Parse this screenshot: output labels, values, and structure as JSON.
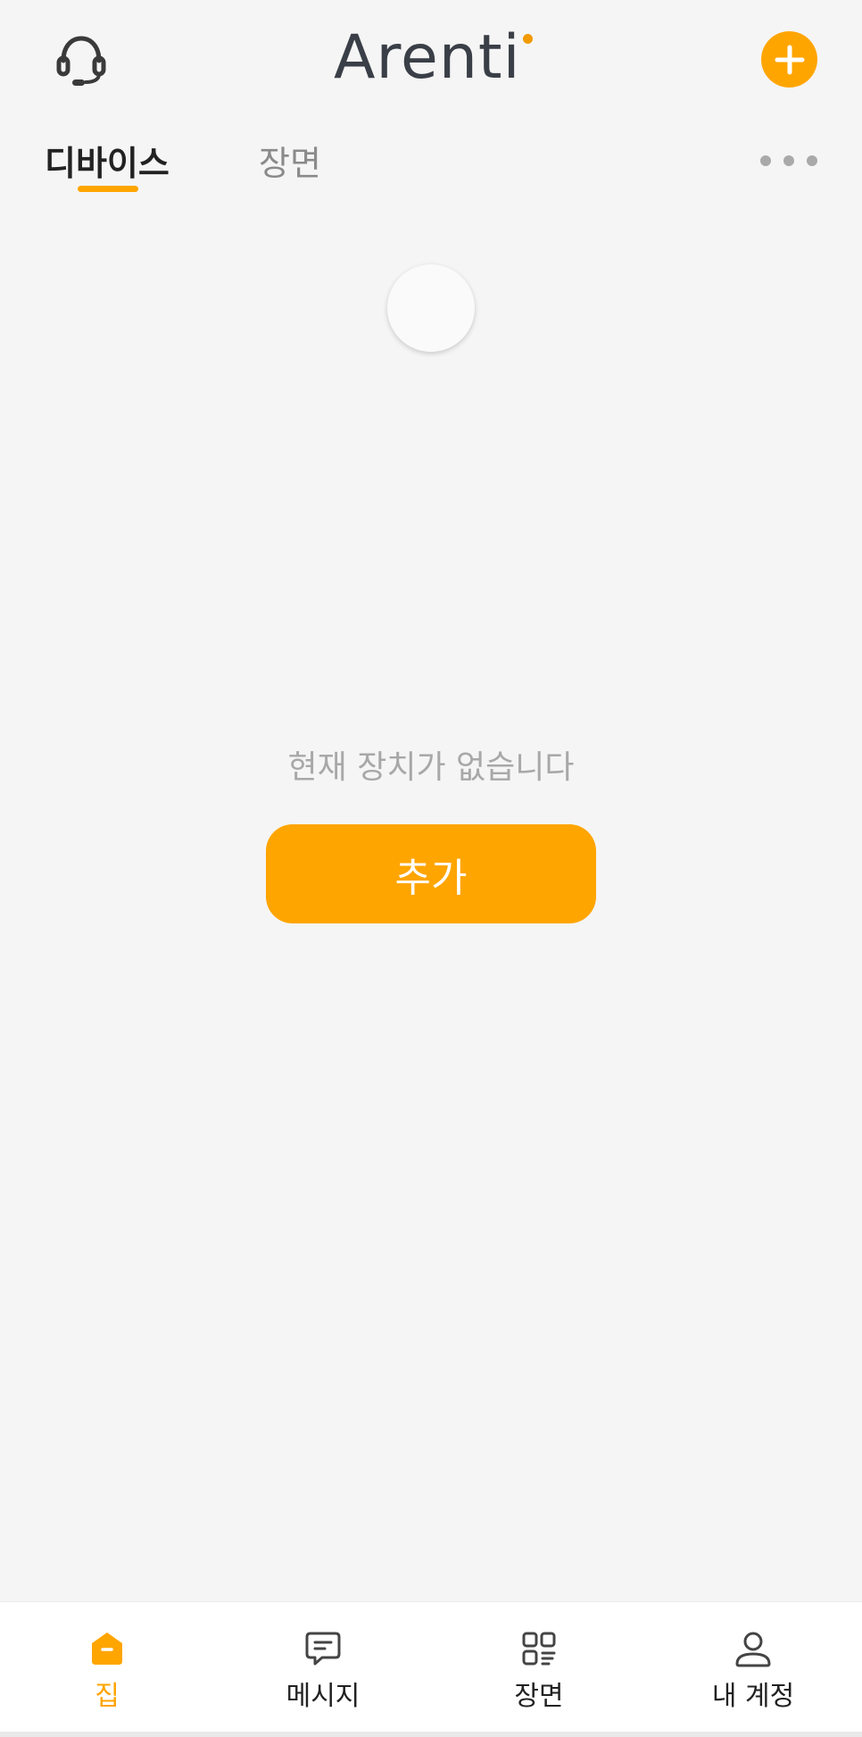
{
  "header": {
    "logo_text": "Arenti",
    "support_icon": "headset-icon",
    "add_icon": "plus-icon"
  },
  "tabs": [
    {
      "label": "디바이스",
      "active": true
    },
    {
      "label": "장면",
      "active": false
    }
  ],
  "more_icon": "more-horizontal-icon",
  "empty_state": {
    "message": "현재 장치가 없습니다",
    "button_label": "추가"
  },
  "bottom_nav": [
    {
      "label": "집",
      "icon": "home-icon",
      "active": true
    },
    {
      "label": "메시지",
      "icon": "message-icon",
      "active": false
    },
    {
      "label": "장면",
      "icon": "scenes-icon",
      "active": false
    },
    {
      "label": "내 계정",
      "icon": "account-icon",
      "active": false
    }
  ],
  "colors": {
    "accent": "#ffa500",
    "background": "#f5f5f5",
    "text_primary": "#222222",
    "text_muted": "#a8a8a8"
  }
}
